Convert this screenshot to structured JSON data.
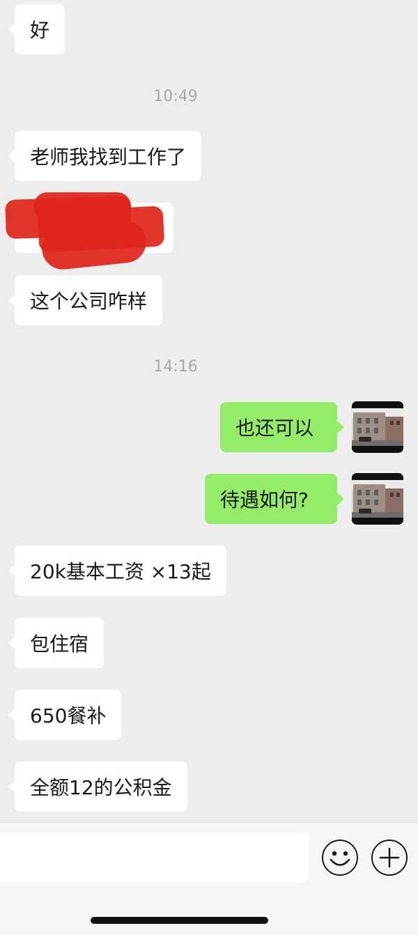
{
  "messages": [
    {
      "text": "好"
    },
    {
      "text": "老师我找到工作了"
    },
    {
      "text": "这个公司咋样"
    },
    {
      "text": "也还可以"
    },
    {
      "text": "待遇如何?"
    },
    {
      "text": "20k基本工资 ×13起"
    },
    {
      "text": "包住宿"
    },
    {
      "text": "650餐补"
    },
    {
      "text": "全额12的公积金"
    }
  ],
  "timestamps": [
    "10:49",
    "14:16"
  ],
  "input_bar": {
    "emoji_icon": "emoji-icon",
    "plus_icon": "plus-icon"
  },
  "colors": {
    "background": "#ededed",
    "incoming_bubble": "#ffffff",
    "outgoing_bubble": "#95ec69",
    "timestamp": "#a8a8a8",
    "redaction": "#e0251b"
  }
}
